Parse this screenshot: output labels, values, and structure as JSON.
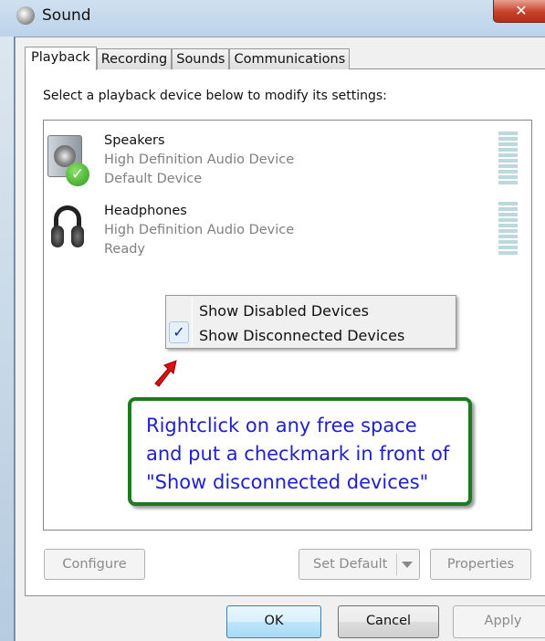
{
  "window": {
    "title": "Sound",
    "close_icon": "close-icon"
  },
  "tabs": [
    {
      "label": "Playback",
      "active": true
    },
    {
      "label": "Recording"
    },
    {
      "label": "Sounds"
    },
    {
      "label": "Communications"
    }
  ],
  "instruction": "Select a playback device below to modify its settings:",
  "devices": [
    {
      "name": "Speakers",
      "driver": "High Definition Audio Device",
      "status": "Default Device",
      "icon": "speaker-icon",
      "default": true
    },
    {
      "name": "Headphones",
      "driver": "High Definition Audio Device",
      "status": "Ready",
      "icon": "headphones-icon"
    }
  ],
  "context_menu": [
    {
      "label": "Show Disabled Devices",
      "checked": false
    },
    {
      "label": "Show Disconnected Devices",
      "checked": true
    }
  ],
  "annotation": {
    "line1": "Rightclick on any free space",
    "line2": "and put a checkmark in front of",
    "line3": "\"Show disconnected devices\"",
    "border_color": "#1e7a1e",
    "text_color": "#2020d0"
  },
  "buttons": {
    "configure": "Configure",
    "set_default": "Set Default",
    "properties": "Properties",
    "ok": "OK",
    "cancel": "Cancel",
    "apply": "Apply"
  }
}
